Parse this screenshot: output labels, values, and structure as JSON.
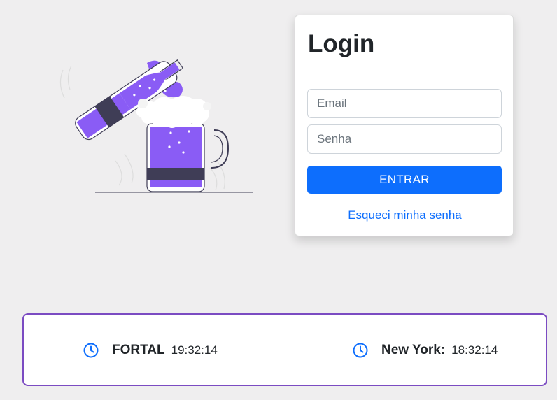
{
  "login": {
    "title": "Login",
    "email_placeholder": "Email",
    "password_placeholder": "Senha",
    "submit_label": "ENTRAR",
    "forgot_link": "Esqueci minha senha"
  },
  "clocks": [
    {
      "city": "FORTAL",
      "time": "19:32:14",
      "icon": "clock-icon"
    },
    {
      "city": "New York:",
      "time": "18:32:14",
      "icon": "clock-icon"
    }
  ],
  "illustration": {
    "subject": "beer bottle pouring into mug",
    "accent_color": "#8a5cf5",
    "dark_color": "#3f3d56"
  },
  "colors": {
    "background": "#efeeef",
    "primary": "#0d6efd",
    "panel_border": "#7b4bc2"
  }
}
